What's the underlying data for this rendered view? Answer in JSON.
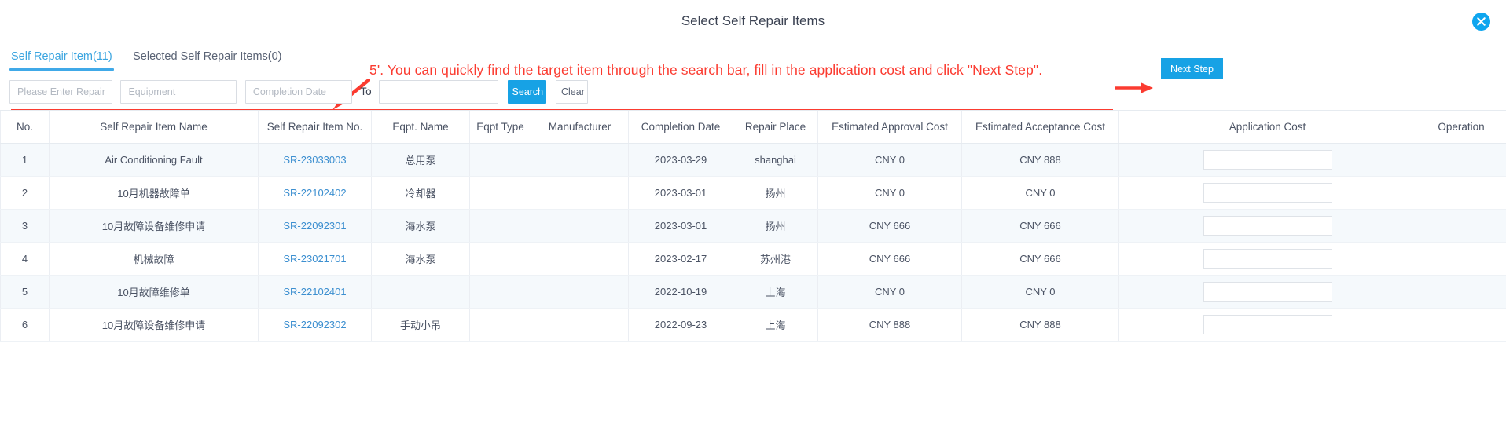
{
  "header": {
    "title": "Select Self Repair Items",
    "close_icon": "close-circle-icon"
  },
  "tabs": [
    {
      "label": "Self Repair Item(11)",
      "active": true
    },
    {
      "label": "Selected Self Repair Items(0)",
      "active": false
    }
  ],
  "annotation": {
    "text": "5'. You can quickly find the target item through the search bar, fill in the application cost and click \"Next Step\".",
    "color": "#fb3b30",
    "left_arrow_icon": "arrow-down-left-icon",
    "right_arrow_icon": "arrow-right-icon"
  },
  "next_step": {
    "label": "Next Step",
    "color": "#17a2e5"
  },
  "search": {
    "repair_item_name": {
      "value": "",
      "placeholder": "Please Enter Repair Item N"
    },
    "equipment": {
      "value": "",
      "placeholder": "Equipment"
    },
    "completion_date_from": {
      "value": "",
      "placeholder": "Completion Date"
    },
    "to_label": "To",
    "completion_date_to": {
      "value": "",
      "placeholder": ""
    },
    "search_label": "Search",
    "clear_label": "Clear"
  },
  "table": {
    "columns": [
      "No.",
      "Self Repair Item Name",
      "Self Repair Item No.",
      "Eqpt. Name",
      "Eqpt Type",
      "Manufacturer",
      "Completion Date",
      "Repair Place",
      "Estimated Approval Cost",
      "Estimated Acceptance Cost",
      "Application Cost",
      "Operation"
    ],
    "rows": [
      {
        "no": "1",
        "name": "Air Conditioning Fault",
        "item_no": "SR-23033003",
        "eqpt_name": "总用泵",
        "eqpt_type": "",
        "manufacturer": "",
        "completion_date": "2023-03-29",
        "repair_place": "shanghai",
        "approval_cost": "CNY 0",
        "acceptance_cost": "CNY 888",
        "application_cost": "",
        "operation": ""
      },
      {
        "no": "2",
        "name": "10月机器故障单",
        "item_no": "SR-22102402",
        "eqpt_name": "冷却器",
        "eqpt_type": "",
        "manufacturer": "",
        "completion_date": "2023-03-01",
        "repair_place": "扬州",
        "approval_cost": "CNY 0",
        "acceptance_cost": "CNY 0",
        "application_cost": "",
        "operation": ""
      },
      {
        "no": "3",
        "name": "10月故障设备维修申请",
        "item_no": "SR-22092301",
        "eqpt_name": "海水泵",
        "eqpt_type": "",
        "manufacturer": "",
        "completion_date": "2023-03-01",
        "repair_place": "扬州",
        "approval_cost": "CNY 666",
        "acceptance_cost": "CNY 666",
        "application_cost": "",
        "operation": ""
      },
      {
        "no": "4",
        "name": "机械故障",
        "item_no": "SR-23021701",
        "eqpt_name": "海水泵",
        "eqpt_type": "",
        "manufacturer": "",
        "completion_date": "2023-02-17",
        "repair_place": "苏州港",
        "approval_cost": "CNY 666",
        "acceptance_cost": "CNY 666",
        "application_cost": "",
        "operation": ""
      },
      {
        "no": "5",
        "name": "10月故障维修单",
        "item_no": "SR-22102401",
        "eqpt_name": "",
        "eqpt_type": "",
        "manufacturer": "",
        "completion_date": "2022-10-19",
        "repair_place": "上海",
        "approval_cost": "CNY 0",
        "acceptance_cost": "CNY 0",
        "application_cost": "",
        "operation": ""
      },
      {
        "no": "6",
        "name": "10月故障设备维修申请",
        "item_no": "SR-22092302",
        "eqpt_name": "手动小吊",
        "eqpt_type": "",
        "manufacturer": "",
        "completion_date": "2022-09-23",
        "repair_place": "上海",
        "approval_cost": "CNY 888",
        "acceptance_cost": "CNY 888",
        "application_cost": "",
        "operation": ""
      }
    ]
  }
}
